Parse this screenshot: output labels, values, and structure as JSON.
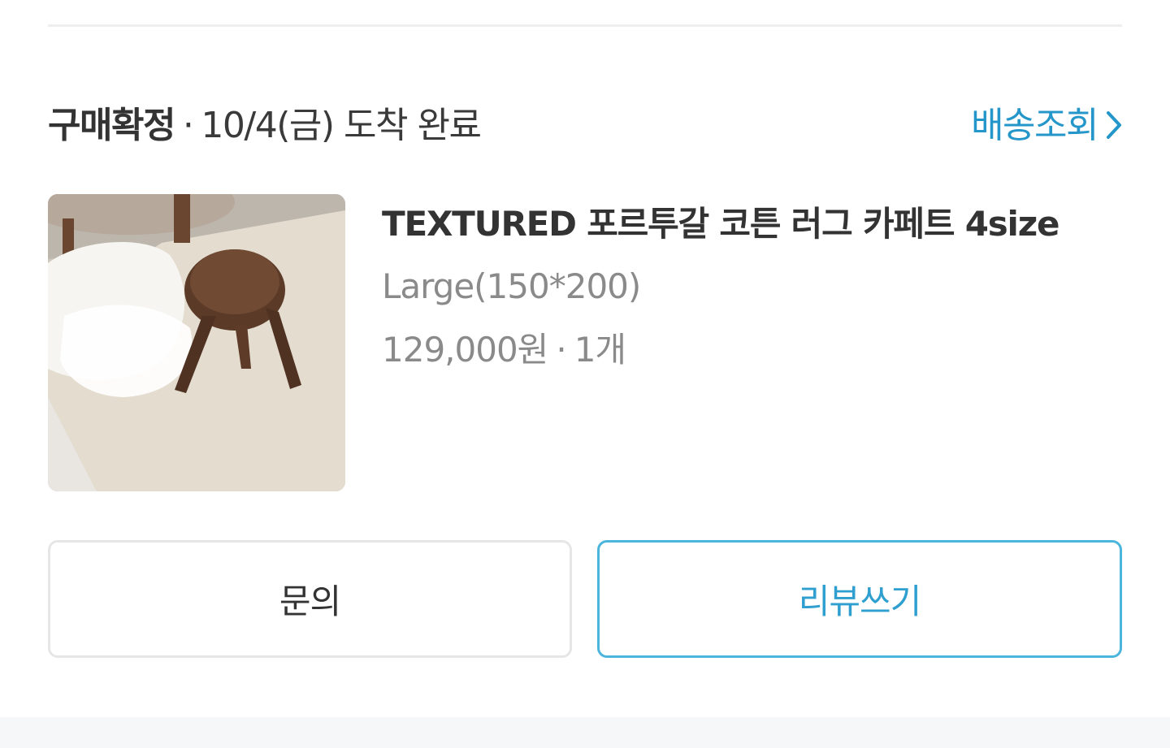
{
  "order": {
    "status": "구매확정",
    "separator": "·",
    "delivery_text": "10/4(금) 도착 완료",
    "tracking_label": "배송조회",
    "tracking_icon": "chevron-right-icon"
  },
  "product": {
    "image_alt": "product-photo",
    "name": "TEXTURED 포르투갈 코튼 러그 카페트 4size",
    "option": "Large(150*200)",
    "price": "129,000원",
    "quantity": "1개",
    "price_separator": "·"
  },
  "actions": {
    "inquiry_label": "문의",
    "review_label": "리뷰쓰기"
  },
  "colors": {
    "accent": "#2596c9",
    "review_border": "#4cb5dc",
    "muted_text": "#8a8a8a",
    "divider": "#eeeeee"
  }
}
